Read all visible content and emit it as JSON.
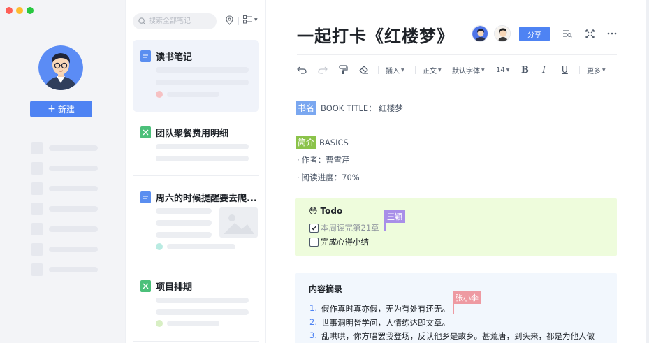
{
  "colors": {
    "accent": "#4e83f3",
    "traffic_red": "#fe5f57",
    "traffic_yellow": "#febc2e",
    "traffic_green": "#28c840",
    "tag_book": "#7aa7f0",
    "tag_intro": "#8bc34a",
    "todo_bg": "#eefcdc",
    "summary_bg": "#f2f7fd",
    "cursor_wang": "#a88ee8",
    "cursor_zhang": "#ee9aa2"
  },
  "sidebar": {
    "new_button_label": "新建",
    "new_button_icon": "plus-icon"
  },
  "list": {
    "search_placeholder": "搜索全部笔记",
    "items": [
      {
        "title": "读书笔记",
        "icon": "doc-icon"
      },
      {
        "title": "团队聚餐费用明细",
        "icon": "sheet-icon"
      },
      {
        "title": "周六的时候提醒要去爬...",
        "icon": "doc-icon"
      },
      {
        "title": "项目排期",
        "icon": "sheet-icon"
      }
    ]
  },
  "doc": {
    "title": "一起打卡《红楼梦》",
    "share_label": "分享",
    "toolbar": {
      "insert": "插入",
      "paragraph": "正文",
      "font": "默认字体",
      "size": "14",
      "bold": "B",
      "italic": "I",
      "underline": "U",
      "more": "更多"
    },
    "book_tag": "书名",
    "book_line": "BOOK TITLE： 红楼梦",
    "intro_tag": "简介",
    "intro_label": "BASICS",
    "author_line": "作者：曹雪芹",
    "progress_line": "阅读进度：70%",
    "bullet": "·",
    "todo": {
      "emoji": "😳",
      "title": "Todo",
      "items": [
        {
          "text": "本周读完第21章",
          "checked": true
        },
        {
          "text": "完成心得小结",
          "checked": false
        }
      ],
      "cursor_user": "王颖"
    },
    "summary": {
      "title": "内容摘录",
      "items": [
        {
          "num": "1.",
          "text": "假作真时真亦假，无为有处有还无。"
        },
        {
          "num": "2.",
          "text": "世事洞明皆学问，人情练达即文章。"
        },
        {
          "num": "3.",
          "text": "乱哄哄，你方唱罢我登场，反认他乡是故乡。甚荒唐，到头来，都是为他人做"
        }
      ],
      "cursor_user": "张小李"
    }
  }
}
